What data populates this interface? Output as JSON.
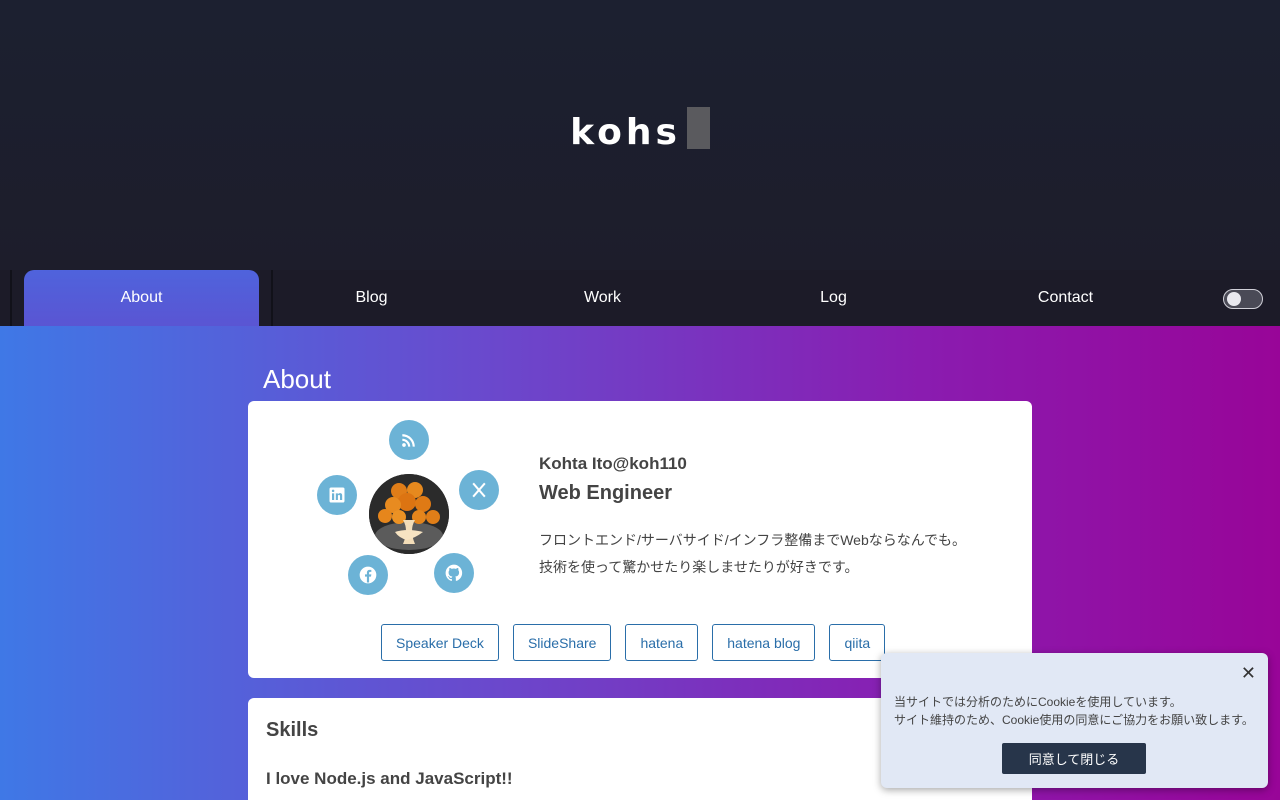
{
  "header": {
    "logo": "kohs"
  },
  "nav": {
    "items": [
      {
        "label": "About"
      },
      {
        "label": "Blog"
      },
      {
        "label": "Work"
      },
      {
        "label": "Log"
      },
      {
        "label": "Contact"
      }
    ],
    "theme_toggle": false
  },
  "about": {
    "title": "About",
    "handle": "Kohta Ito@koh110",
    "role": "Web Engineer",
    "bio": [
      "フロントエンド/サーバサイド/インフラ整備までWebならなんでも。",
      "技術を使って驚かせたり楽しませたりが好きです。"
    ],
    "socials": [
      "rss-icon",
      "x-icon",
      "github-icon",
      "facebook-icon",
      "linkedin-icon"
    ],
    "links": [
      "Speaker Deck",
      "SlideShare",
      "hatena",
      "hatena blog",
      "qiita"
    ]
  },
  "skills": {
    "title": "Skills",
    "subtitle": "I love Node.js and JavaScript!!"
  },
  "cookie": {
    "text": [
      "当サイトでは分析のためにCookieを使用しています。",
      "サイト維持のため、Cookie使用の同意にご協力をお願い致します。"
    ],
    "close_label": "✕",
    "accept_label": "同意して閉じる"
  },
  "colors": {
    "accent": "#5a5ad6",
    "social_bg": "#6cb3d6",
    "link": "#2a6ea9",
    "cookie_button": "#27354a"
  }
}
